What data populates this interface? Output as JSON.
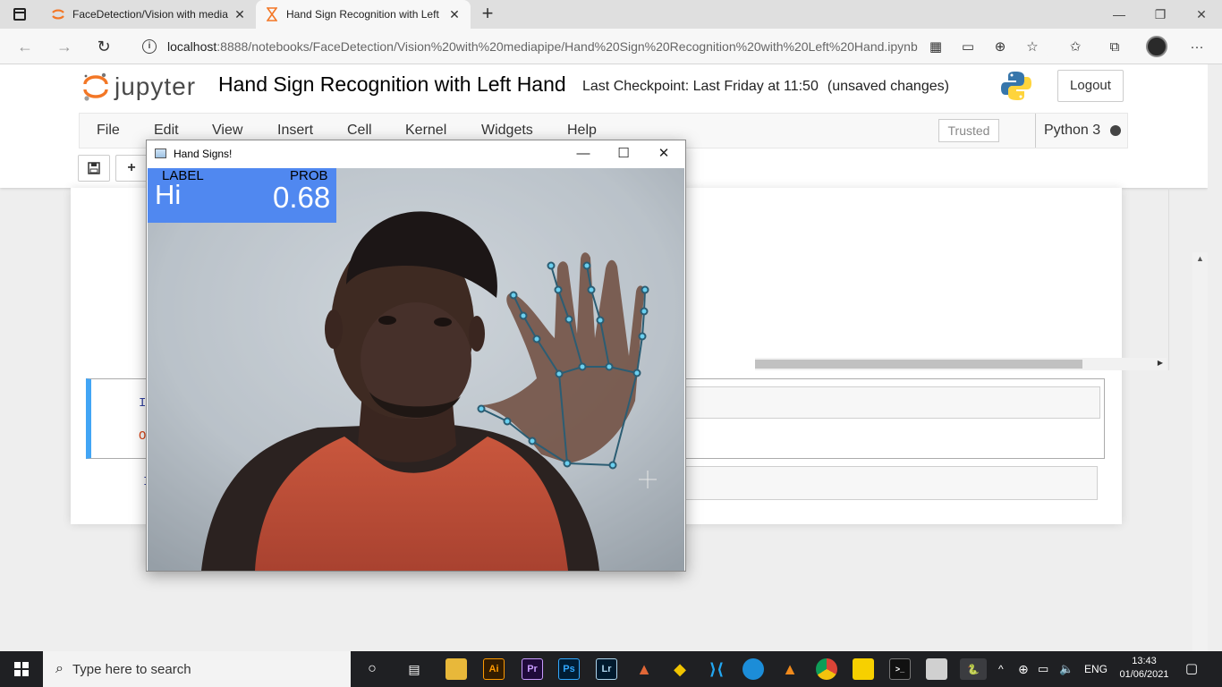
{
  "browser": {
    "tabs": [
      {
        "title": "FaceDetection/Vision with media",
        "icon": "jupyter-spinner-icon"
      },
      {
        "title": "Hand Sign Recognition with Left",
        "icon": "hourglass-icon"
      }
    ],
    "url_host": "localhost",
    "url_path": ":8888/notebooks/FaceDetection/Vision%20with%20mediapipe/Hand%20Sign%20Recognition%20with%20Left%20Hand.ipynb"
  },
  "jupyter": {
    "logo_text": "jupyter",
    "notebook_title": "Hand Sign Recognition with Left Hand",
    "checkpoint_text": "Last Checkpoint: Last Friday at 11:50",
    "unsaved_text": "(unsaved changes)",
    "logout_label": "Logout",
    "menu": [
      "File",
      "Edit",
      "View",
      "Insert",
      "Cell",
      "Kernel",
      "Widgets",
      "Help"
    ],
    "trusted_label": "Trusted",
    "kernel_name": "Python 3",
    "cell_in_prompt": "In",
    "cell_out_prompt": "Ou",
    "cell3_prompt": "I"
  },
  "cv_window": {
    "title": "Hand Signs!",
    "hud_label_caption": "LABEL",
    "hud_prob_caption": "PROB",
    "predicted_class": "Hi",
    "probability": "0.68",
    "hud_color": "#5088f0"
  },
  "taskbar": {
    "search_placeholder": "Type here to search",
    "language": "ENG",
    "time": "13:43",
    "date": "01/06/2021",
    "pinned": [
      "Task View",
      "File Explorer",
      "Ai",
      "Pr",
      "Ps",
      "Lr",
      "MATLAB",
      "Git",
      "VS Code",
      "Edge",
      "VLC",
      "Chrome",
      "Sticky Notes",
      "Terminal",
      "Explorer window",
      "Python"
    ]
  }
}
